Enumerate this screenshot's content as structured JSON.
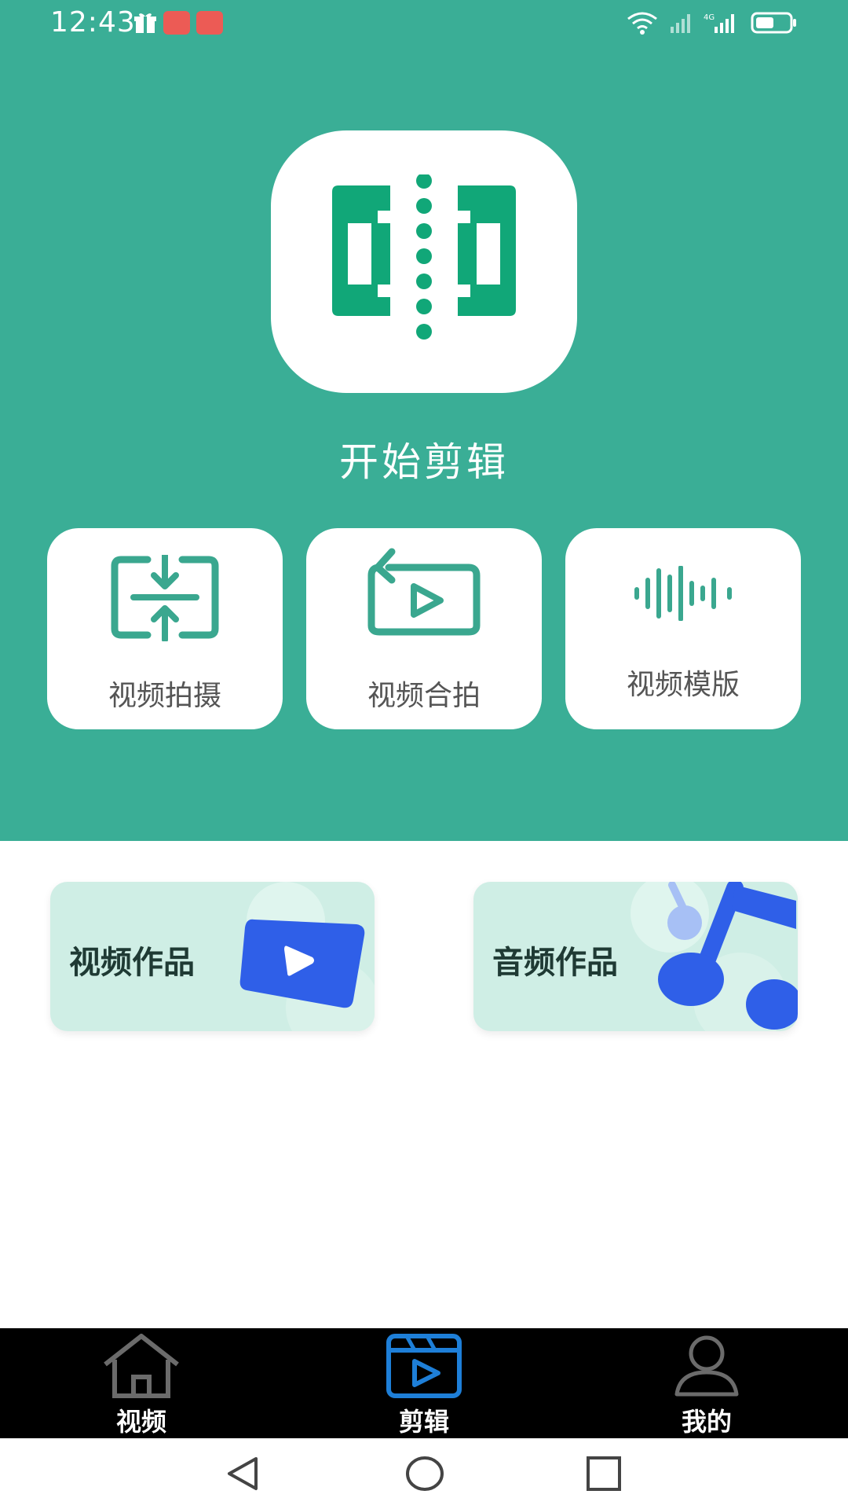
{
  "status_bar": {
    "time": "12:43"
  },
  "hero": {
    "title": "开始剪辑"
  },
  "actions": [
    {
      "label": "视频拍摄",
      "icon": "compress-icon"
    },
    {
      "label": "视频合拍",
      "icon": "replay-video-icon"
    },
    {
      "label": "视频模版",
      "icon": "waveform-icon"
    }
  ],
  "works": [
    {
      "label": "视频作品",
      "icon": "video-play-icon"
    },
    {
      "label": "音频作品",
      "icon": "music-note-icon"
    }
  ],
  "tab_bar": {
    "tabs": [
      {
        "label": "视频",
        "icon": "home-icon",
        "active": false
      },
      {
        "label": "剪辑",
        "icon": "clapperboard-icon",
        "active": true
      },
      {
        "label": "我的",
        "icon": "user-icon",
        "active": false
      }
    ]
  },
  "colors": {
    "hero_bg": "#3aae96",
    "brand_green": "#11a778",
    "accent_blue": "#2f5fe8",
    "active_tab": "#1e7fd8"
  }
}
